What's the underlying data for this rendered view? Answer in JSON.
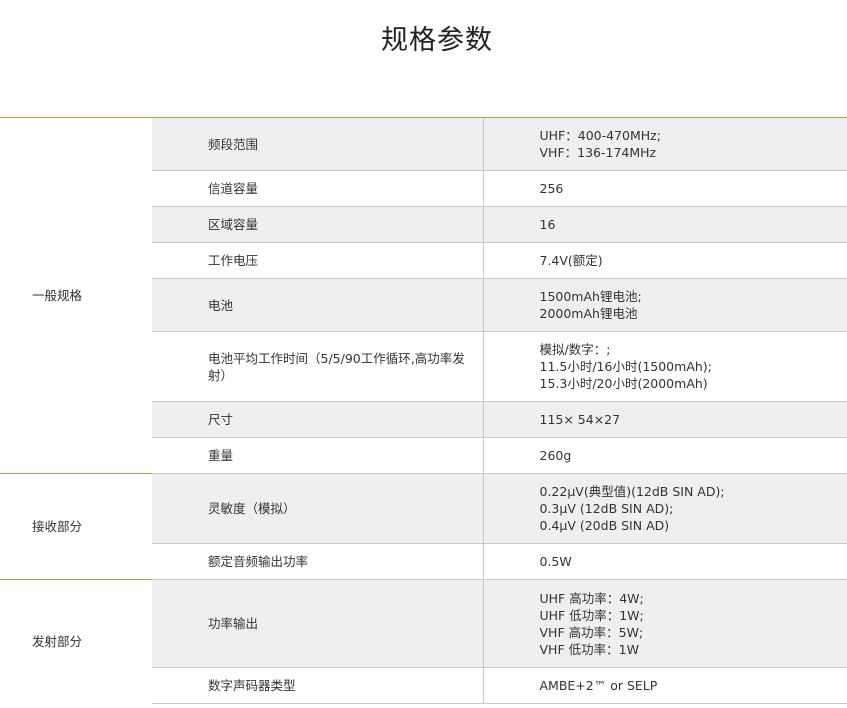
{
  "page": {
    "title": "规格参数"
  },
  "groups": [
    {
      "name": "一般规格",
      "rows": [
        {
          "label": "频段范围",
          "values": [
            "UHF：400-470MHz;",
            "VHF：136-174MHz"
          ]
        },
        {
          "label": "信道容量",
          "values": [
            "256"
          ]
        },
        {
          "label": "区域容量",
          "values": [
            "16"
          ]
        },
        {
          "label": "工作电压",
          "values": [
            "7.4V(额定)"
          ]
        },
        {
          "label": "电池",
          "values": [
            "1500mAh锂电池;",
            "2000mAh锂电池"
          ]
        },
        {
          "label": "电池平均工作时间（5/5/90工作循环,高功率发射）",
          "values": [
            "模拟/数字：;",
            "11.5小时/16小时(1500mAh);",
            "15.3小时/20小时(2000mAh)"
          ]
        },
        {
          "label": "尺寸",
          "values": [
            "115× 54×27"
          ]
        },
        {
          "label": "重量",
          "values": [
            "260g"
          ]
        }
      ]
    },
    {
      "name": "接收部分",
      "rows": [
        {
          "label": "灵敏度（模拟）",
          "values": [
            "0.22µV(典型值)(12dB SIN AD);",
            "0.3µV (12dB SIN AD);",
            "0.4µV (20dB SIN AD)"
          ]
        },
        {
          "label": "额定音频输出功率",
          "values": [
            "0.5W"
          ]
        }
      ]
    },
    {
      "name": "发射部分",
      "rows": [
        {
          "label": "功率输出",
          "values": [
            "UHF 高功率：4W;",
            "UHF 低功率：1W;",
            "VHF 高功率：5W;",
            "VHF 低功率：1W"
          ]
        },
        {
          "label": "数字声码器类型",
          "values": [
            "AMBE+2™ or SELP"
          ]
        }
      ]
    }
  ],
  "colors": {
    "accent": "#8cb63c",
    "shade": "#efefef",
    "border": "#c9c9c9"
  }
}
